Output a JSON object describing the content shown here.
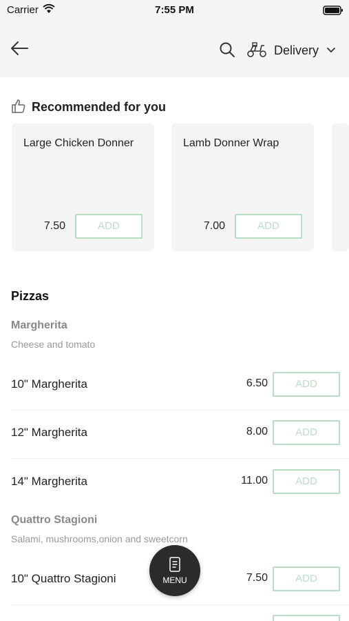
{
  "status_bar": {
    "carrier": "Carrier",
    "time": "7:55 PM"
  },
  "header": {
    "delivery_label": "Delivery"
  },
  "recommended": {
    "title": "Recommended for you",
    "items": [
      {
        "name": "Large Chicken Donner",
        "price": "7.50",
        "add_label": "ADD"
      },
      {
        "name": "Lamb Donner Wrap",
        "price": "7.00",
        "add_label": "ADD"
      }
    ]
  },
  "menu": {
    "section_title": "Pizzas",
    "groups": [
      {
        "name": "Margherita",
        "description": "Cheese and tomato",
        "items": [
          {
            "name": "10\" Margherita",
            "price": "6.50",
            "add_label": "ADD"
          },
          {
            "name": "12\" Margherita",
            "price": "8.00",
            "add_label": "ADD"
          },
          {
            "name": "14\" Margherita",
            "price": "11.00",
            "add_label": "ADD"
          }
        ]
      },
      {
        "name": "Quattro Stagioni",
        "description": "Salami, mushrooms,onion and sweetcorn",
        "items": [
          {
            "name": "10\" Quattro Stagioni",
            "price": "7.50",
            "add_label": "ADD"
          }
        ]
      }
    ]
  },
  "fab": {
    "label": "MENU"
  },
  "colors": {
    "add_border": "#b9dcc5",
    "card_bg": "#f4f4f4",
    "header_bg": "#f5f5f5",
    "fab_bg": "#2b2b2b"
  },
  "icons": [
    "wifi-icon",
    "battery-icon",
    "back-arrow-icon",
    "search-icon",
    "scooter-icon",
    "chevron-down-icon",
    "thumbs-up-icon",
    "menu-book-icon"
  ]
}
